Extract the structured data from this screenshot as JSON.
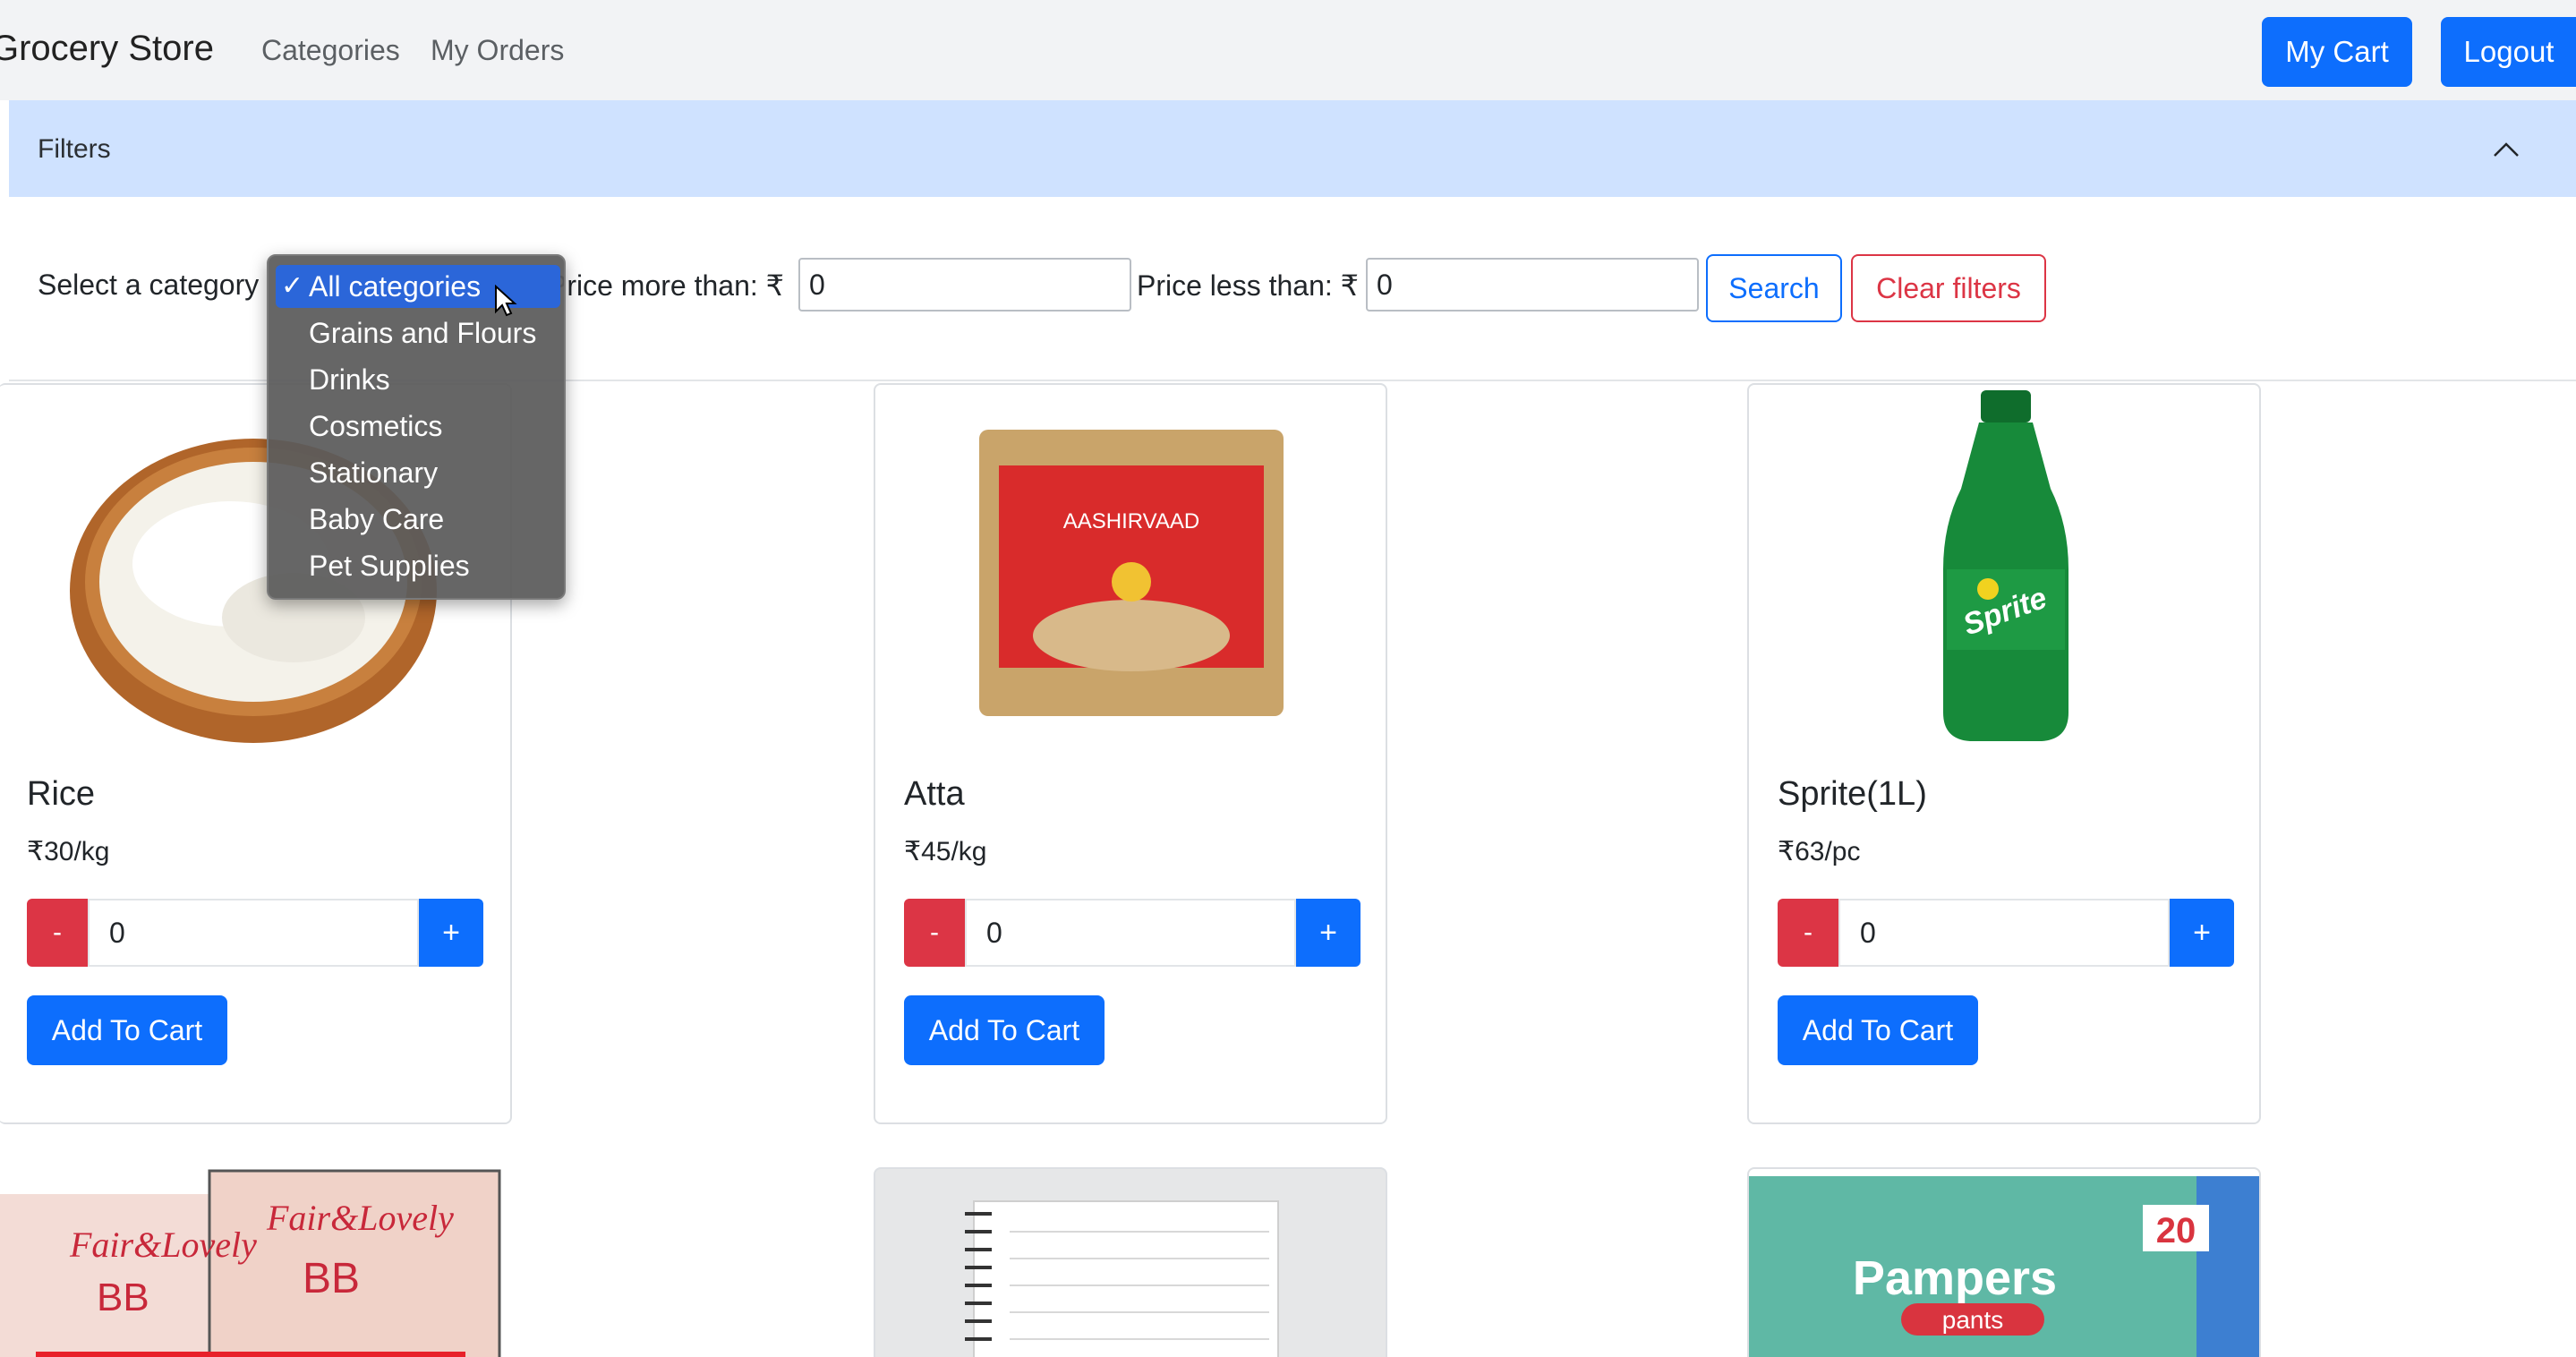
{
  "navbar": {
    "brand": "Grocery Store",
    "links": [
      "Categories",
      "My Orders"
    ],
    "my_cart": "My Cart",
    "logout": "Logout"
  },
  "filters": {
    "title": "Filters",
    "category_label": "Select a category",
    "price_more_label": "Price more than: ₹",
    "price_more_value": "0",
    "price_less_label": "Price less than: ₹",
    "price_less_value": "0",
    "search": "Search",
    "clear": "Clear filters"
  },
  "dropdown": {
    "options": [
      "All categories",
      "Grains and Flours",
      "Drinks",
      "Cosmetics",
      "Stationary",
      "Baby Care",
      "Pet Supplies"
    ],
    "selected": "All categories"
  },
  "products": [
    {
      "name": "Rice",
      "price": "₹30/kg",
      "qty": "0",
      "minus": "-",
      "plus": "+",
      "add": "Add To Cart"
    },
    {
      "name": "Atta",
      "price": "₹45/kg",
      "qty": "0",
      "minus": "-",
      "plus": "+",
      "add": "Add To Cart"
    },
    {
      "name": "Sprite(1L)",
      "price": "₹63/pc",
      "qty": "0",
      "minus": "-",
      "plus": "+",
      "add": "Add To Cart"
    }
  ],
  "product_images": {
    "atta_brand": "AASHIRVAAD",
    "sprite_brand": "Sprite",
    "cosmetics_brand": "Fair&Lovely",
    "cosmetics_sub": "BB",
    "pampers_brand": "Pampers",
    "pampers_sub": "pants",
    "pampers_count": "20"
  },
  "colors": {
    "primary": "#0d6efd",
    "danger": "#dc3545",
    "filters_bg": "#cfe2ff",
    "navbar_bg": "#f2f3f5"
  }
}
